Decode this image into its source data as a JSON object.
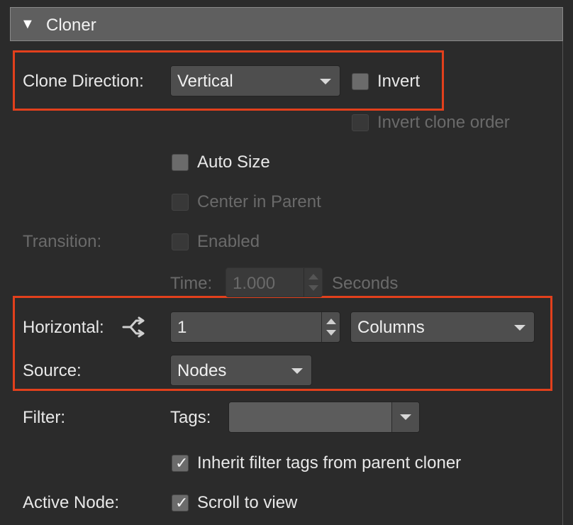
{
  "panel": {
    "title": "Cloner"
  },
  "clone_direction": {
    "label": "Clone Direction:",
    "value": "Vertical",
    "invert_label": "Invert",
    "invert_checked": false,
    "invert_order_label": "Invert clone order",
    "invert_order_enabled": false
  },
  "auto_size": {
    "label": "Auto Size",
    "checked": false
  },
  "center_in_parent": {
    "label": "Center in Parent",
    "enabled": false
  },
  "transition": {
    "label": "Transition:",
    "enabled_label": "Enabled",
    "time_label": "Time:",
    "time_value": "1.000",
    "unit_label": "Seconds"
  },
  "horizontal": {
    "label": "Horizontal:",
    "value": "1",
    "mode": "Columns"
  },
  "source": {
    "label": "Source:",
    "value": "Nodes"
  },
  "filter": {
    "label": "Filter:",
    "tags_label": "Tags:",
    "tags_value": "",
    "inherit_label": "Inherit filter tags from parent cloner",
    "inherit_checked": true
  },
  "active_node": {
    "label": "Active Node:",
    "scroll_label": "Scroll to view",
    "scroll_checked": true
  },
  "colors": {
    "highlight": "#e2401c",
    "background": "#2b2b2b",
    "header": "#5f5f5f"
  }
}
